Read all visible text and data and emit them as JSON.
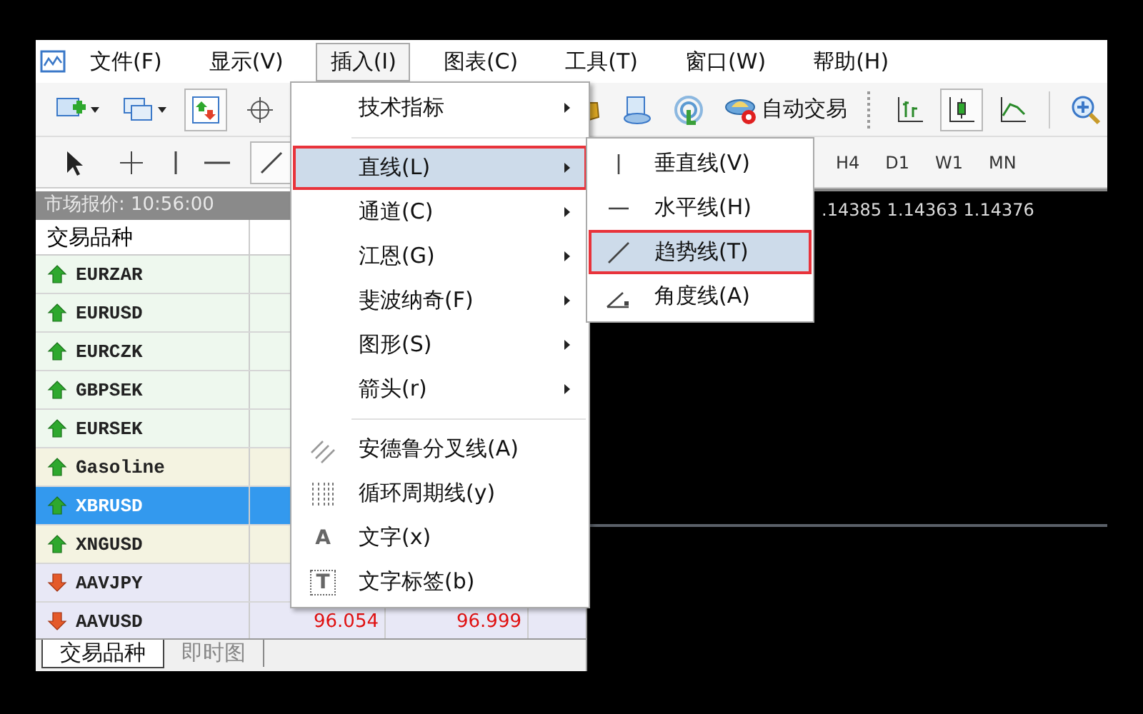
{
  "menubar": {
    "items": [
      {
        "label": "文件(F)",
        "selected": false
      },
      {
        "label": "显示(V)",
        "selected": false
      },
      {
        "label": "插入(I)",
        "selected": true
      },
      {
        "label": "图表(C)",
        "selected": false
      },
      {
        "label": "工具(T)",
        "selected": false
      },
      {
        "label": "窗口(W)",
        "selected": false
      },
      {
        "label": "帮助(H)",
        "selected": false
      }
    ]
  },
  "toolbar": {
    "left_tools": [
      {
        "kind": "new_chart",
        "pressed": false,
        "caret": true
      },
      {
        "kind": "profiles",
        "pressed": false,
        "caret": true
      },
      {
        "kind": "market_watch",
        "pressed": true,
        "caret": false
      },
      {
        "kind": "crosshair",
        "pressed": false,
        "caret": false
      }
    ],
    "right_tools": [
      {
        "kind": "gold",
        "pressed": false
      },
      {
        "kind": "navigator",
        "pressed": false
      },
      {
        "kind": "signals",
        "pressed": false
      }
    ],
    "auto_trading": {
      "label": "自动交易"
    },
    "chart_tools": [
      {
        "kind": "bars",
        "pressed": false
      },
      {
        "kind": "candles",
        "pressed": true
      },
      {
        "kind": "line",
        "pressed": false
      }
    ],
    "zoom_tools": [
      {
        "kind": "zoom_in",
        "pressed": false
      }
    ]
  },
  "drawing_toolbar": {
    "tools": [
      {
        "kind": "cursor",
        "pressed": false
      },
      {
        "kind": "crosshair",
        "pressed": false
      },
      {
        "kind": "vline",
        "pressed": false
      },
      {
        "kind": "hline",
        "pressed": false
      },
      {
        "kind": "trendline",
        "pressed": true
      }
    ],
    "timeframes": [
      "H4",
      "D1",
      "W1",
      "MN"
    ]
  },
  "market_watch": {
    "title": "市场报价: 10:56:00",
    "columns": [
      "交易品种"
    ],
    "rows": [
      {
        "symbol": "EURZAR",
        "kind": "up",
        "selected": false,
        "color": "#eef8ee",
        "cells": []
      },
      {
        "symbol": "EURUSD",
        "kind": "up",
        "selected": false,
        "color": "#eef8ee",
        "cells": []
      },
      {
        "symbol": "EURCZK",
        "kind": "up",
        "selected": false,
        "color": "#eef8ee",
        "cells": []
      },
      {
        "symbol": "GBPSEK",
        "kind": "up",
        "selected": false,
        "color": "#eef8ee",
        "cells": []
      },
      {
        "symbol": "EURSEK",
        "kind": "up",
        "selected": false,
        "color": "#eef8ee",
        "cells": []
      },
      {
        "symbol": "Gasoline",
        "kind": "up",
        "selected": false,
        "color": "#f4f3e1",
        "cells": []
      },
      {
        "symbol": "XBRUSD",
        "kind": "up",
        "selected": true,
        "cells": []
      },
      {
        "symbol": "XNGUSD",
        "kind": "up",
        "selected": false,
        "color": "#f4f3e1",
        "cells": []
      },
      {
        "symbol": "AAVJPY",
        "kind": "down",
        "selected": false,
        "color": "#e8e8f6",
        "cells": []
      },
      {
        "symbol": "AAVUSD",
        "kind": "down",
        "selected": false,
        "color": "#e8e8f6",
        "cells": [
          "96.054",
          "96.999"
        ]
      }
    ],
    "tabs": [
      {
        "label": "交易品种",
        "selected": true
      },
      {
        "label": "即时图",
        "selected": false
      }
    ]
  },
  "chart": {
    "quote": ".14385 1.14363 1.14376"
  },
  "insert_menu": {
    "groups": [
      [
        {
          "label": "技术指标",
          "submenu": true,
          "selected": false
        }
      ],
      [
        {
          "label": "直线(L)",
          "submenu": true,
          "selected": true
        },
        {
          "label": "通道(C)",
          "submenu": true,
          "selected": false
        },
        {
          "label": "江恩(G)",
          "submenu": true,
          "selected": false
        },
        {
          "label": "斐波纳奇(F)",
          "submenu": true,
          "selected": false
        },
        {
          "label": "图形(S)",
          "submenu": true,
          "selected": false
        },
        {
          "label": "箭头(r)",
          "submenu": true,
          "selected": false
        }
      ],
      [
        {
          "label": "安德鲁分叉线(A)",
          "submenu": false,
          "selected": false,
          "kind": "pitchfork"
        },
        {
          "label": "循环周期线(y)",
          "submenu": false,
          "selected": false,
          "kind": "cycles"
        },
        {
          "label": "文字(x)",
          "submenu": false,
          "selected": false,
          "kind": "text",
          "icon_text": "A"
        },
        {
          "label": "文字标签(b)",
          "submenu": false,
          "selected": false,
          "kind": "label",
          "icon_text": "T"
        }
      ]
    ]
  },
  "lines_submenu": {
    "items": [
      {
        "label": "垂直线(V)",
        "kind": "vline",
        "selected": false
      },
      {
        "label": "水平线(H)",
        "kind": "hline",
        "selected": false
      },
      {
        "label": "趋势线(T)",
        "kind": "trendline",
        "selected": true
      },
      {
        "label": "角度线(A)",
        "kind": "angle",
        "selected": false
      }
    ]
  }
}
